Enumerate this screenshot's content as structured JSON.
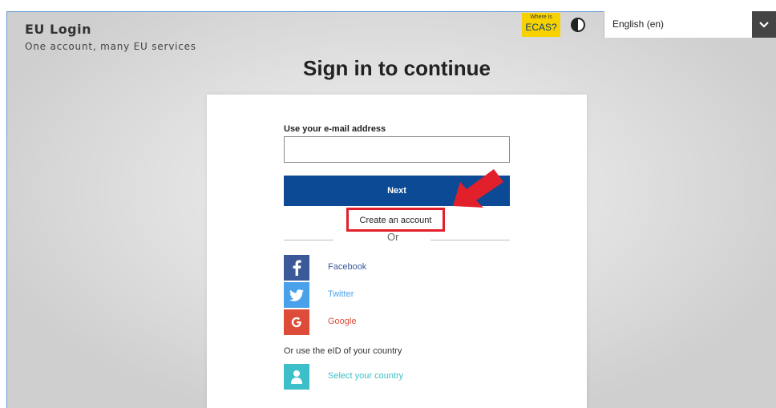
{
  "header": {
    "brand_title": "EU Login",
    "brand_subtitle": "One account, many EU services",
    "ecas_small": "Where is",
    "ecas_big": "ECAS?",
    "language": "English (en)"
  },
  "main": {
    "heading": "Sign in to continue",
    "email_label": "Use your e-mail address",
    "email_value": "",
    "next_label": "Next",
    "create_account": "Create an account",
    "or_label": "Or",
    "social": [
      {
        "label": "Facebook",
        "icon": "facebook-icon",
        "color": "#3b5998"
      },
      {
        "label": "Twitter",
        "icon": "twitter-icon",
        "color": "#4aa1eb"
      },
      {
        "label": "Google",
        "icon": "google-icon",
        "color": "#dd4b39"
      }
    ],
    "eid_text": "Or use the eID of your country",
    "country_label": "Select your country",
    "country_color": "#3dbfc9"
  },
  "colors": {
    "accent": "#0d4a96",
    "highlight": "#e1202b",
    "ecas_bg": "#f7d200"
  }
}
